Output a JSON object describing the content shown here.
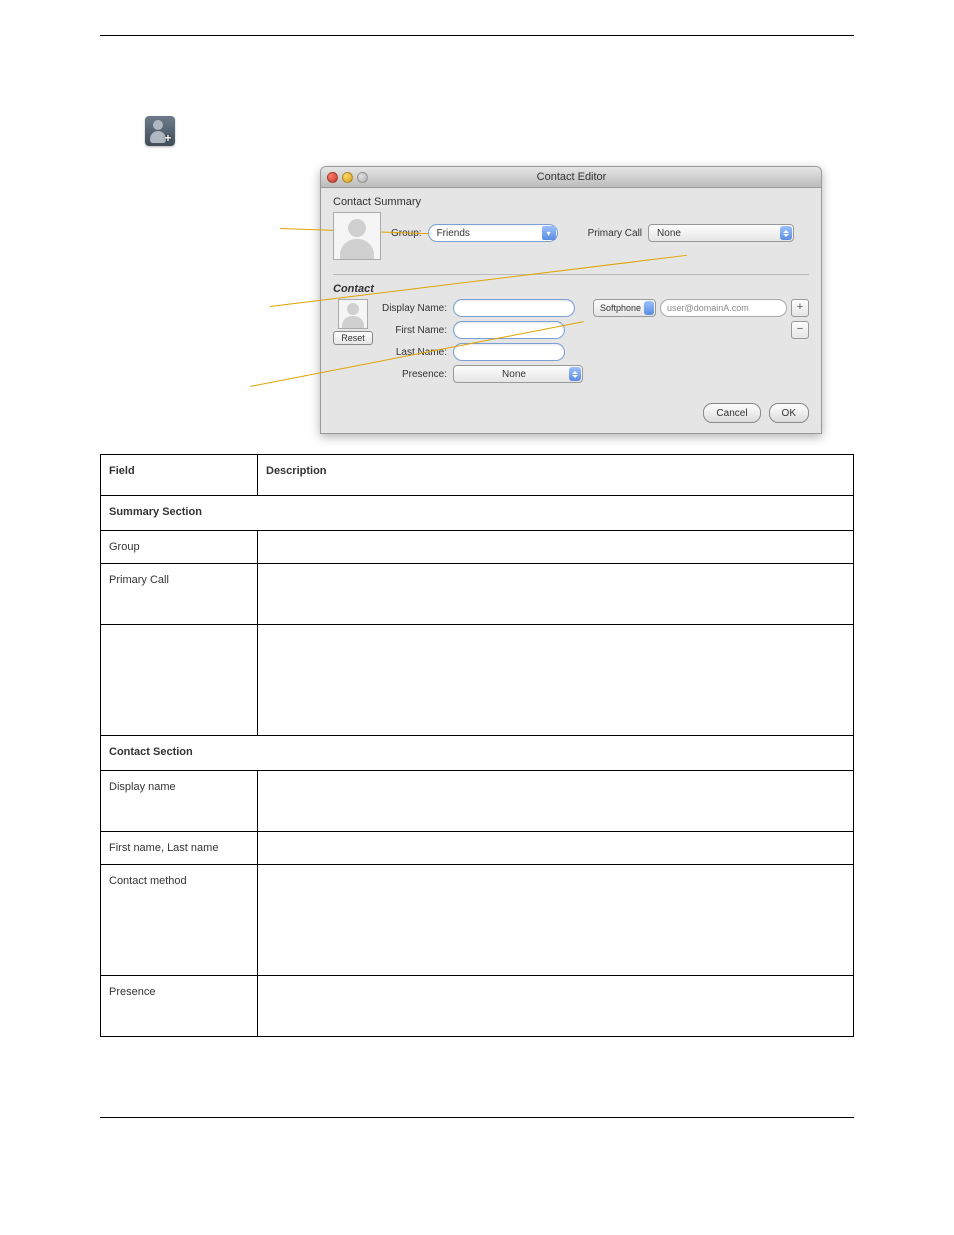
{
  "dialog": {
    "title": "Contact Editor",
    "summary_label": "Contact Summary",
    "contact_label": "Contact",
    "group_label": "Group:",
    "group_value": "Friends",
    "primary_label": "Primary Call",
    "primary_value": "None",
    "display_name_label": "Display Name:",
    "first_name_label": "First Name:",
    "last_name_label": "Last Name:",
    "presence_label": "Presence:",
    "presence_value": "None",
    "reset_label": "Reset",
    "method_type": "Softphone",
    "method_placeholder": "user@domainA.com",
    "cancel": "Cancel",
    "ok": "OK"
  },
  "table": {
    "header_field": "Field",
    "header_desc": "Description",
    "sections": [
      "Summary Section",
      "Contact Section"
    ],
    "rows1": [
      {
        "field": "Group",
        "desc": ""
      },
      {
        "field": "Primary Call",
        "desc": ""
      },
      {
        "field": "",
        "desc": ""
      }
    ],
    "rows2": [
      {
        "field": "Display name",
        "desc": ""
      },
      {
        "field": "First name, Last name",
        "desc": ""
      },
      {
        "field": "Contact method",
        "desc": ""
      },
      {
        "field": "Presence",
        "desc": ""
      }
    ]
  }
}
